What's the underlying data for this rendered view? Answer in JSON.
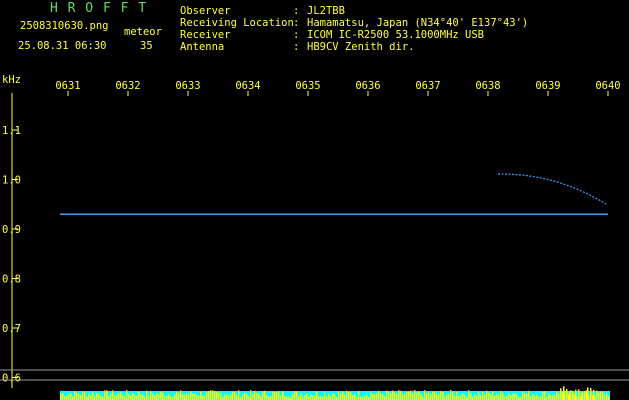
{
  "header": {
    "app_name": "H R O F F T",
    "filename": "2508310630.png",
    "timestamp": "25.08.31 06:30",
    "meteor_label": "meteor",
    "meteor_count": "35"
  },
  "info": {
    "observer_label": "Observer",
    "observer_value": "JL2TBB",
    "location_label": "Receiving Location",
    "location_value": "Hamamatsu, Japan (N34°40' E137°43')",
    "receiver_label": "Receiver",
    "receiver_value": "ICOM IC-R2500 53.1000MHz USB",
    "antenna_label": "Antenna",
    "antenna_value": "HB9CV Zenith dir."
  },
  "axes": {
    "y_unit": "kHz",
    "x_ticks": [
      "0631",
      "0632",
      "0633",
      "0634",
      "0635",
      "0636",
      "0637",
      "0638",
      "0639",
      "0640"
    ],
    "y_ticks": [
      "1.1",
      "1.0",
      "0.9",
      "0.8",
      "0.7",
      "0.6"
    ]
  },
  "colors": {
    "text": "#ffff40",
    "header": "#5fdc5f",
    "axis": "#ffff40",
    "trace": "#3aa0ff",
    "activity_cyan": "#00ffff",
    "activity_yellow": "#ffff00"
  },
  "chart_data": {
    "type": "line",
    "y_unit": "kHz",
    "x": [
      "0631",
      "0632",
      "0633",
      "0634",
      "0635",
      "0636",
      "0637",
      "0638",
      "0639",
      "0640"
    ],
    "series": [
      {
        "values": [
          0.93,
          0.93,
          0.93,
          0.93,
          0.93,
          0.93,
          0.93,
          0.93,
          0.93,
          0.93
        ]
      }
    ],
    "ylim": [
      0.58,
      1.18
    ]
  }
}
